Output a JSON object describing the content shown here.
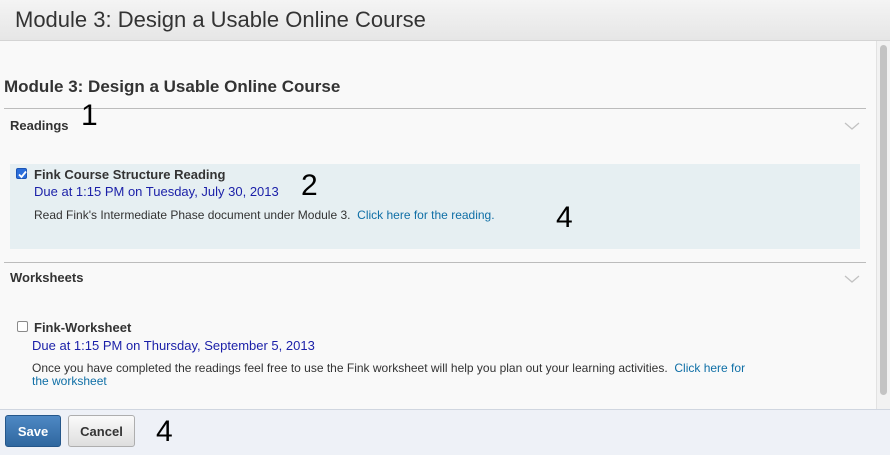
{
  "window": {
    "title": "Module 3: Design a Usable Online Course"
  },
  "module": {
    "heading": "Module 3: Design a Usable Online Course"
  },
  "sections": [
    {
      "title": "Readings",
      "annotation": "1",
      "items": [
        {
          "name": "Fink Course Structure Reading",
          "checked": true,
          "due": "Due at 1:15 PM on Tuesday, July 30, 2013",
          "due_annotation": "2",
          "description": "Read Fink's Intermediate Phase document under Module 3.",
          "link_text": "Click here for the reading.",
          "link_annotation": "4"
        }
      ]
    },
    {
      "title": "Worksheets",
      "items": [
        {
          "name": "Fink-Worksheet",
          "checked": false,
          "due": "Due at 1:15 PM on Thursday, September 5, 2013",
          "description": "Once you have completed the readings feel free to use the Fink worksheet will help you plan out your learning activities.",
          "link_text_line1": "Click here for",
          "link_text_line2": "the worksheet"
        }
      ]
    }
  ],
  "footer": {
    "save_label": "Save",
    "cancel_label": "Cancel",
    "annotation": "4"
  },
  "colors": {
    "accent": "#2f679f",
    "due_text": "#1a1fa8",
    "link": "#0f6fa6",
    "highlight": "#e6eff2"
  }
}
